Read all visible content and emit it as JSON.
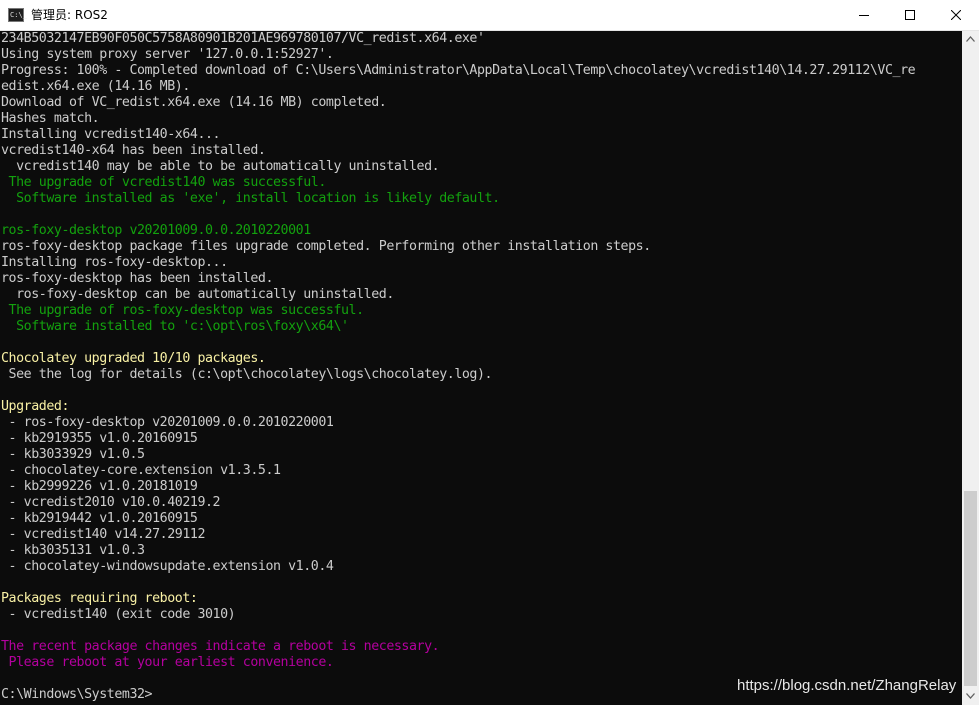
{
  "window": {
    "title": "管理员: ROS2",
    "icon": "console-icon",
    "icon_glyph": "C:\\_",
    "controls": [
      "minimize-icon",
      "maximize-icon",
      "close-icon"
    ]
  },
  "colors": {
    "background": "#0c0c0c",
    "default_text": "#cccccc",
    "success_text": "#13a10e",
    "highlight_text": "#f9f1a5",
    "warning_text": "#b4009e"
  },
  "console": {
    "lines": [
      {
        "text": "234B5032147EB90F050C5758A80901B201AE969780107/VC_redist.x64.exe'",
        "color": "gray"
      },
      {
        "text": "Using system proxy server '127.0.0.1:52927'.",
        "color": "gray"
      },
      {
        "text": "Progress: 100% - Completed download of C:\\Users\\Administrator\\AppData\\Local\\Temp\\chocolatey\\vcredist140\\14.27.29112\\VC_re",
        "color": "gray"
      },
      {
        "text": "edist.x64.exe (14.16 MB).",
        "color": "gray"
      },
      {
        "text": "Download of VC_redist.x64.exe (14.16 MB) completed.",
        "color": "gray"
      },
      {
        "text": "Hashes match.",
        "color": "gray"
      },
      {
        "text": "Installing vcredist140-x64...",
        "color": "gray"
      },
      {
        "text": "vcredist140-x64 has been installed.",
        "color": "gray"
      },
      {
        "text": "  vcredist140 may be able to be automatically uninstalled.",
        "color": "gray"
      },
      {
        "text": " The upgrade of vcredist140 was successful.",
        "color": "green"
      },
      {
        "text": "  Software installed as 'exe', install location is likely default.",
        "color": "green"
      },
      {
        "text": "",
        "color": "gray"
      },
      {
        "text": "ros-foxy-desktop v20201009.0.0.2010220001",
        "color": "green"
      },
      {
        "text": "ros-foxy-desktop package files upgrade completed. Performing other installation steps.",
        "color": "gray"
      },
      {
        "text": "Installing ros-foxy-desktop...",
        "color": "gray"
      },
      {
        "text": "ros-foxy-desktop has been installed.",
        "color": "gray"
      },
      {
        "text": "  ros-foxy-desktop can be automatically uninstalled.",
        "color": "gray"
      },
      {
        "text": " The upgrade of ros-foxy-desktop was successful.",
        "color": "green"
      },
      {
        "text": "  Software installed to 'c:\\opt\\ros\\foxy\\x64\\'",
        "color": "green"
      },
      {
        "text": "",
        "color": "gray"
      },
      {
        "text": "Chocolatey upgraded 10/10 packages.",
        "color": "yellow"
      },
      {
        "text": " See the log for details (c:\\opt\\chocolatey\\logs\\chocolatey.log).",
        "color": "gray"
      },
      {
        "text": "",
        "color": "gray"
      },
      {
        "text": "Upgraded:",
        "color": "yellow"
      },
      {
        "text": " - ros-foxy-desktop v20201009.0.0.2010220001",
        "color": "gray"
      },
      {
        "text": " - kb2919355 v1.0.20160915",
        "color": "gray"
      },
      {
        "text": " - kb3033929 v1.0.5",
        "color": "gray"
      },
      {
        "text": " - chocolatey-core.extension v1.3.5.1",
        "color": "gray"
      },
      {
        "text": " - kb2999226 v1.0.20181019",
        "color": "gray"
      },
      {
        "text": " - vcredist2010 v10.0.40219.2",
        "color": "gray"
      },
      {
        "text": " - kb2919442 v1.0.20160915",
        "color": "gray"
      },
      {
        "text": " - vcredist140 v14.27.29112",
        "color": "gray"
      },
      {
        "text": " - kb3035131 v1.0.3",
        "color": "gray"
      },
      {
        "text": " - chocolatey-windowsupdate.extension v1.0.4",
        "color": "gray"
      },
      {
        "text": "",
        "color": "gray"
      },
      {
        "text": "Packages requiring reboot:",
        "color": "yellow"
      },
      {
        "text": " - vcredist140 (exit code 3010)",
        "color": "gray"
      },
      {
        "text": "",
        "color": "gray"
      },
      {
        "text": "The recent package changes indicate a reboot is necessary.",
        "color": "magenta"
      },
      {
        "text": " Please reboot at your earliest convenience.",
        "color": "magenta"
      },
      {
        "text": "",
        "color": "gray"
      },
      {
        "text": "C:\\Windows\\System32>",
        "color": "gray"
      }
    ]
  },
  "watermark": "https://blog.csdn.net/ZhangRelay"
}
